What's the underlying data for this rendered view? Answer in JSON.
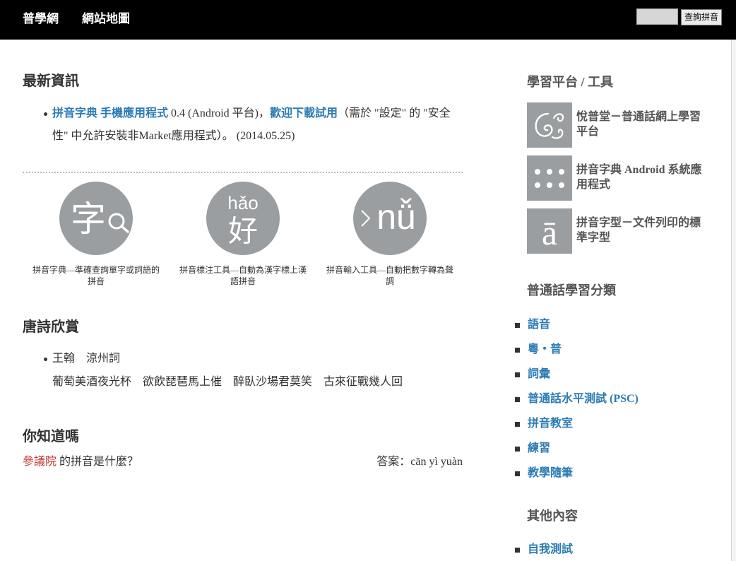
{
  "header": {
    "site_name": "普學網",
    "sitemap_label": "網站地圖",
    "search_button": "查詢拼音"
  },
  "news": {
    "title": "最新資訊",
    "items": [
      {
        "app_link": "拼音字典 手機應用程式",
        "version_text": " 0.4 (Android 平台)，",
        "download_link": "歡迎下載試用",
        "note_text": "（需於 \"設定\" 的 \"安全性\" 中允許安裝非Market應用程式）。 (2014.05.25)"
      }
    ]
  },
  "tools": [
    {
      "icon": "dictionary-magnifier-icon",
      "glyph": "字",
      "caption": "拼音字典—準確查詢單字或詞語的拼音"
    },
    {
      "icon": "pinyin-annotation-icon",
      "pinyin": "hǎo",
      "glyph": "好",
      "caption": "拼音標注工具—自動為漢字標上漢語拼音"
    },
    {
      "icon": "pinyin-input-icon",
      "glyph": "nǚ",
      "caption": "拼音輸入工具—自動把數字轉為聲調"
    }
  ],
  "poetry": {
    "title": "唐詩欣賞",
    "author": "王翰",
    "poem_title": "涼州詞",
    "lines": [
      "葡萄美酒夜光杯",
      "欲飲琵琶馬上催",
      "醉臥沙場君莫笑",
      "古來征戰幾人回"
    ]
  },
  "quiz": {
    "title": "你知道嗎",
    "word": "參議院",
    "question": " 的拼音是什麼？",
    "answer_label": "答案：",
    "answer": "cān yì yuàn"
  },
  "sidebar": {
    "platforms_title": "學習平台 / 工具",
    "platforms": [
      {
        "icon": "swirl-logo-icon",
        "label": "悅普堂－普通話網上學習平台"
      },
      {
        "icon": "dots-grid-icon",
        "label": "拼音字典 Android 系統應用程式"
      },
      {
        "icon": "letter-a-macron-icon",
        "glyph": "ā",
        "label": "拼音字型－文件列印的標準字型"
      }
    ],
    "categories_title": "普通話學習分類",
    "categories": [
      "語音",
      "粵・普",
      "詞彙",
      "普通話水平測試 (PSC)",
      "拼音教室",
      "練習",
      "教學隨筆"
    ],
    "other_title": "其他內容",
    "other": [
      "自我測試"
    ]
  },
  "colors": {
    "header_bg": "#000000",
    "link": "#2b7bb5",
    "text": "#333333",
    "muted": "#555555",
    "icon_bg": "#9a9ea1",
    "highlight": "#c0312b"
  }
}
